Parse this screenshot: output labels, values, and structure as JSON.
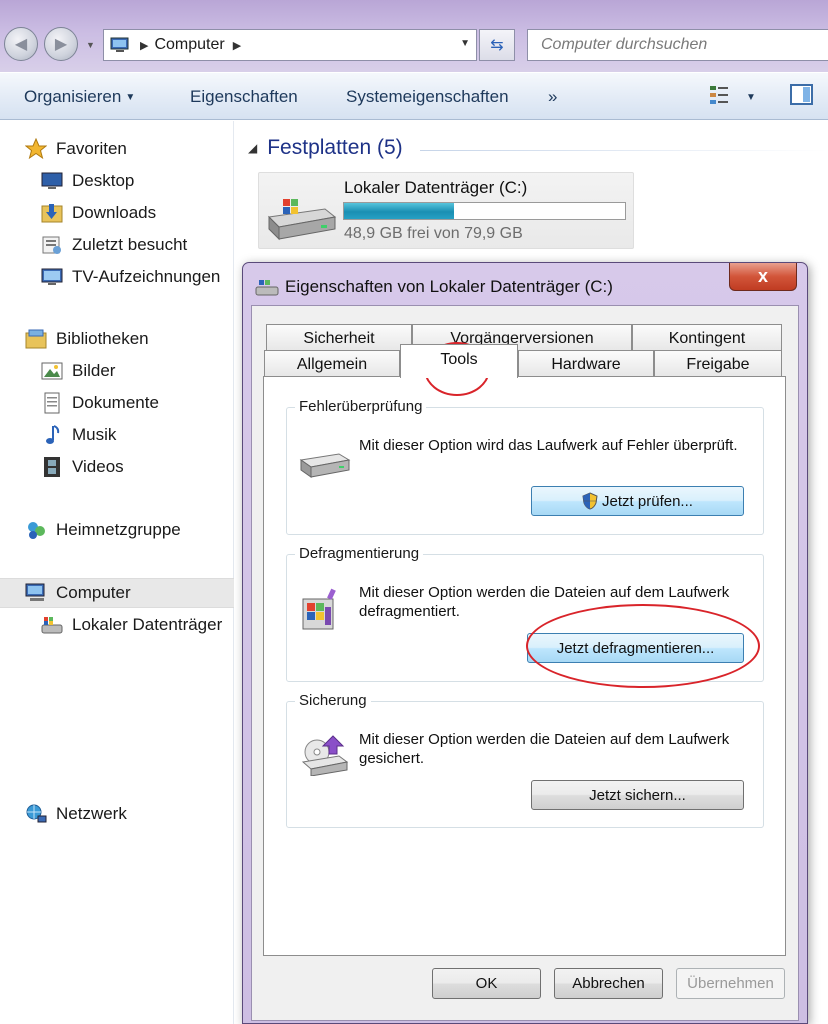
{
  "address_bar": {
    "segment": "Computer"
  },
  "search": {
    "placeholder": "Computer durchsuchen"
  },
  "toolbar": {
    "organize": "Organisieren",
    "properties": "Eigenschaften",
    "system_properties": "Systemeigenschaften",
    "more": "»"
  },
  "nav": {
    "favorites": "Favoriten",
    "desktop": "Desktop",
    "downloads": "Downloads",
    "recent": "Zuletzt besucht",
    "tv": "TV-Aufzeichnungen",
    "libraries": "Bibliotheken",
    "pictures": "Bilder",
    "documents": "Dokumente",
    "music": "Musik",
    "videos": "Videos",
    "homegroup": "Heimnetzgruppe",
    "computer": "Computer",
    "local_disk": "Lokaler Datenträger",
    "network": "Netzwerk"
  },
  "content": {
    "group_title": "Festplatten (5)",
    "drive": {
      "name": "Lokaler Datenträger (C:)",
      "free_text": "48,9 GB frei von 79,9 GB",
      "used_fraction": 0.39
    }
  },
  "dialog": {
    "title": "Eigenschaften von Lokaler Datenträger (C:)",
    "close": "x",
    "tabs_row1": [
      "Sicherheit",
      "Vorgängerversionen",
      "Kontingent"
    ],
    "tabs_row2": [
      "Allgemein",
      "Tools",
      "Hardware",
      "Freigabe"
    ],
    "active_tab": "Tools",
    "error_check": {
      "label": "Fehlerüberprüfung",
      "text": "Mit dieser Option wird das Laufwerk auf Fehler überprüft.",
      "button": "Jetzt prüfen..."
    },
    "defrag": {
      "label": "Defragmentierung",
      "text": "Mit dieser Option werden die Dateien auf dem Laufwerk defragmentiert.",
      "button": "Jetzt defragmentieren..."
    },
    "backup": {
      "label": "Sicherung",
      "text": "Mit dieser Option werden die Dateien auf dem Laufwerk gesichert.",
      "button": "Jetzt sichern..."
    },
    "ok": "OK",
    "cancel": "Abbrechen",
    "apply": "Übernehmen"
  },
  "colors": {
    "titlebar": "#c4b3de",
    "toolbar_text": "#1e395b",
    "group_title": "#1e3287",
    "drive_fill": "#1a8fb3",
    "annotation": "#d9242a"
  }
}
